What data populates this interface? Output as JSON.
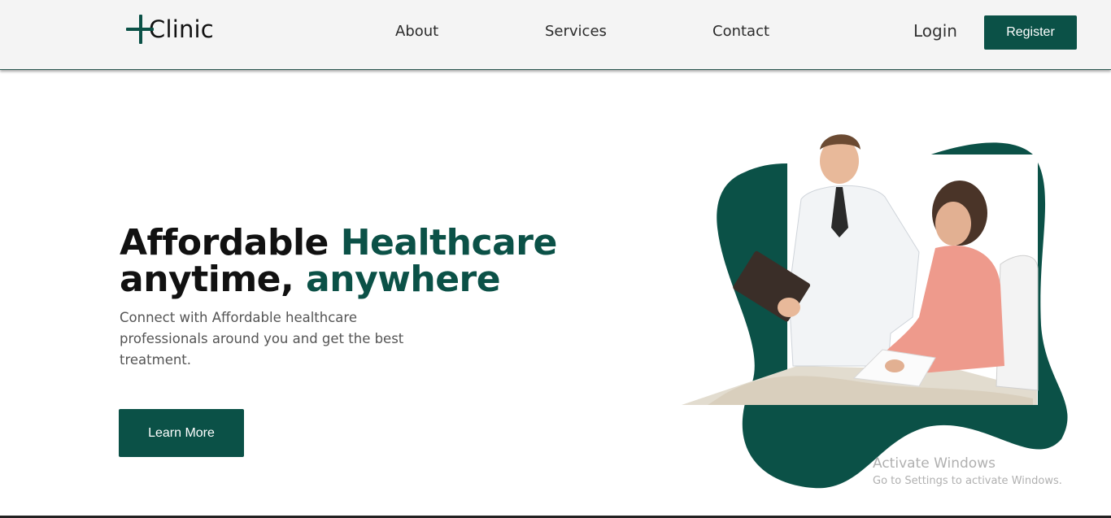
{
  "header": {
    "logo_text": "Clinic",
    "nav": {
      "about": "About",
      "services": "Services",
      "contact": "Contact"
    },
    "login_label": "Login",
    "register_label": "Register"
  },
  "hero": {
    "title_part1": "Affordable ",
    "title_accent1": "Healthcare",
    "title_part2": "anytime, ",
    "title_accent2": "anywhere",
    "description": "Connect with Affordable healthcare professionals around you and get the best treatment.",
    "button_label": "Learn More"
  },
  "watermark": {
    "title": "Activate Windows",
    "subtitle": "Go to Settings to activate Windows."
  },
  "colors": {
    "brand": "#0b5147",
    "text_dark": "#111111",
    "text_muted": "#555555"
  }
}
